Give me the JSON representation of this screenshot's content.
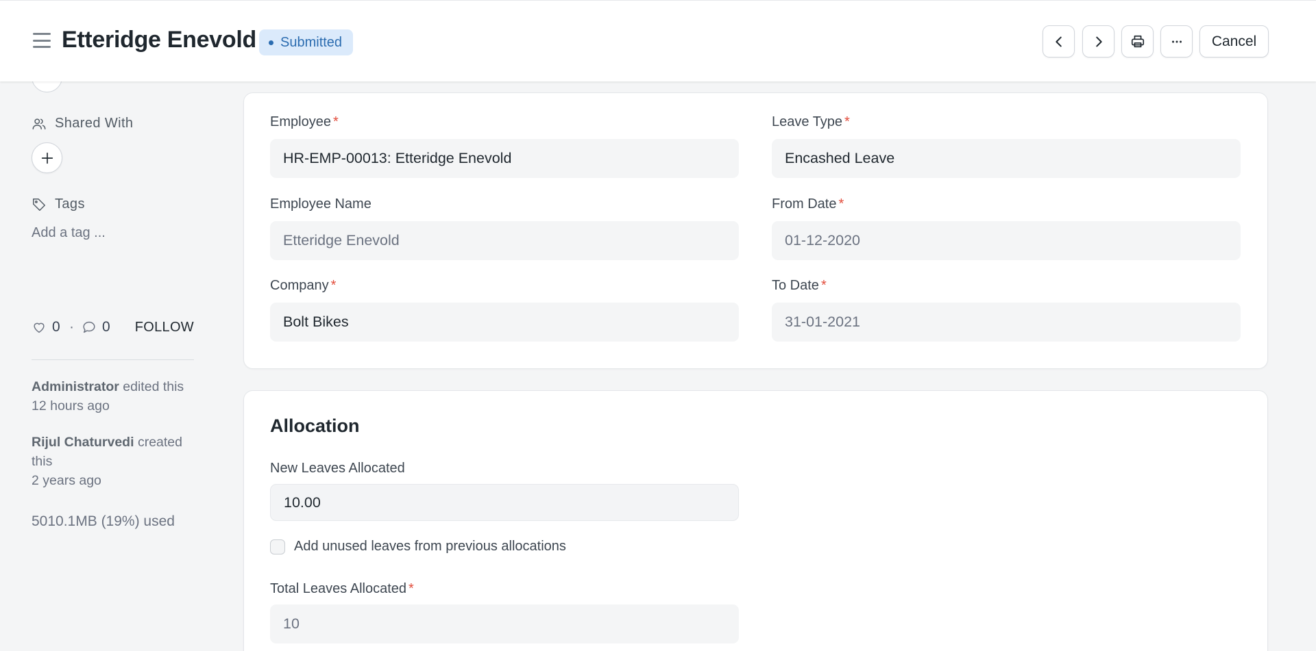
{
  "header": {
    "title": "Etteridge Enevold",
    "status": "Submitted",
    "cancel_label": "Cancel",
    "accent_color": "#2b6cb0"
  },
  "sidebar": {
    "shared_with_label": "Shared With",
    "tags_label": "Tags",
    "add_tag_placeholder": "Add a tag ...",
    "likes": "0",
    "separator": "·",
    "comments": "0",
    "follow_label": "FOLLOW",
    "activity": [
      {
        "user": "Administrator",
        "action": "edited this",
        "time": "12 hours ago"
      },
      {
        "user": "Rijul Chaturvedi",
        "action": "created this",
        "time": "2 years ago"
      }
    ],
    "storage": "5010.1MB (19%) used"
  },
  "details": {
    "employee_label": "Employee",
    "employee_value": "HR-EMP-00013: Etteridge Enevold",
    "leave_type_label": "Leave Type",
    "leave_type_value": "Encashed Leave",
    "employee_name_label": "Employee Name",
    "employee_name_value": "Etteridge Enevold",
    "from_date_label": "From Date",
    "from_date_value": "01-12-2020",
    "company_label": "Company",
    "company_value": "Bolt Bikes",
    "to_date_label": "To Date",
    "to_date_value": "31-01-2021",
    "required_mark": "*"
  },
  "allocation": {
    "section_title": "Allocation",
    "new_leaves_label": "New Leaves Allocated",
    "new_leaves_value": "10.00",
    "carry_forward_label": "Add unused leaves from previous allocations",
    "total_leaves_label": "Total Leaves Allocated",
    "total_leaves_value": "10"
  }
}
